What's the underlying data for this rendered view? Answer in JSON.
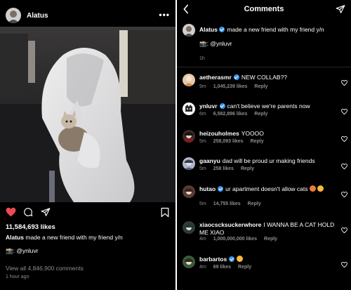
{
  "post": {
    "username": "Alatus",
    "more_icon": "more-dots-icon",
    "likes": "11,584,693 likes",
    "caption_user": "Alatus",
    "caption_text": "made a new friend with my friend y/n",
    "caption_tag": ": @ynluvr",
    "view_all": "View all 4,846,900 comments",
    "time_ago": "1 hour ago",
    "icons": [
      "heart-filled-icon",
      "comment-icon",
      "share-send-icon",
      "bookmark-icon"
    ],
    "colors": {
      "like_red": "#ed4956",
      "muted": "#8e8e8e"
    }
  },
  "comments_screen": {
    "title": "Comments",
    "caption_user": "Alatus",
    "caption_text": "made a new friend with my friend y/n",
    "caption_tag": ": @ynluvr",
    "caption_time": "1h",
    "comments": [
      {
        "user": "aetherasmr",
        "verified": true,
        "text": "NEW COLLAB??",
        "time": "9m",
        "likes": "1,045,239 likes",
        "reply": "Reply"
      },
      {
        "user": "ynluvr",
        "verified": true,
        "text": "can't believe we're parents now",
        "time": "6m",
        "likes": "6,582,896 likes",
        "reply": "Reply"
      },
      {
        "user": "heizouholmes",
        "verified": false,
        "text": "YOOOO",
        "time": "5m",
        "likes": "258,093 likes",
        "reply": "Reply"
      },
      {
        "user": "gaanyu",
        "verified": false,
        "text": "dad will be proud ur making friends",
        "time": "5m",
        "likes": "258 likes",
        "reply": "Reply"
      },
      {
        "user": "hutao",
        "verified": true,
        "text": "ur apartment doesn't allow cats",
        "time": "5m",
        "likes": "14,755 likes",
        "reply": "Reply"
      },
      {
        "user": "xiaocscksuckerwhore",
        "verified": false,
        "text": "I WANNA BE A CAT HOLD ME XIAO",
        "time": "4m",
        "likes": "1,000,000,000 likes",
        "reply": "Reply"
      },
      {
        "user": "barbartos",
        "verified": true,
        "text": "",
        "time": "4m",
        "likes": "69 likes",
        "reply": "Reply"
      }
    ]
  }
}
